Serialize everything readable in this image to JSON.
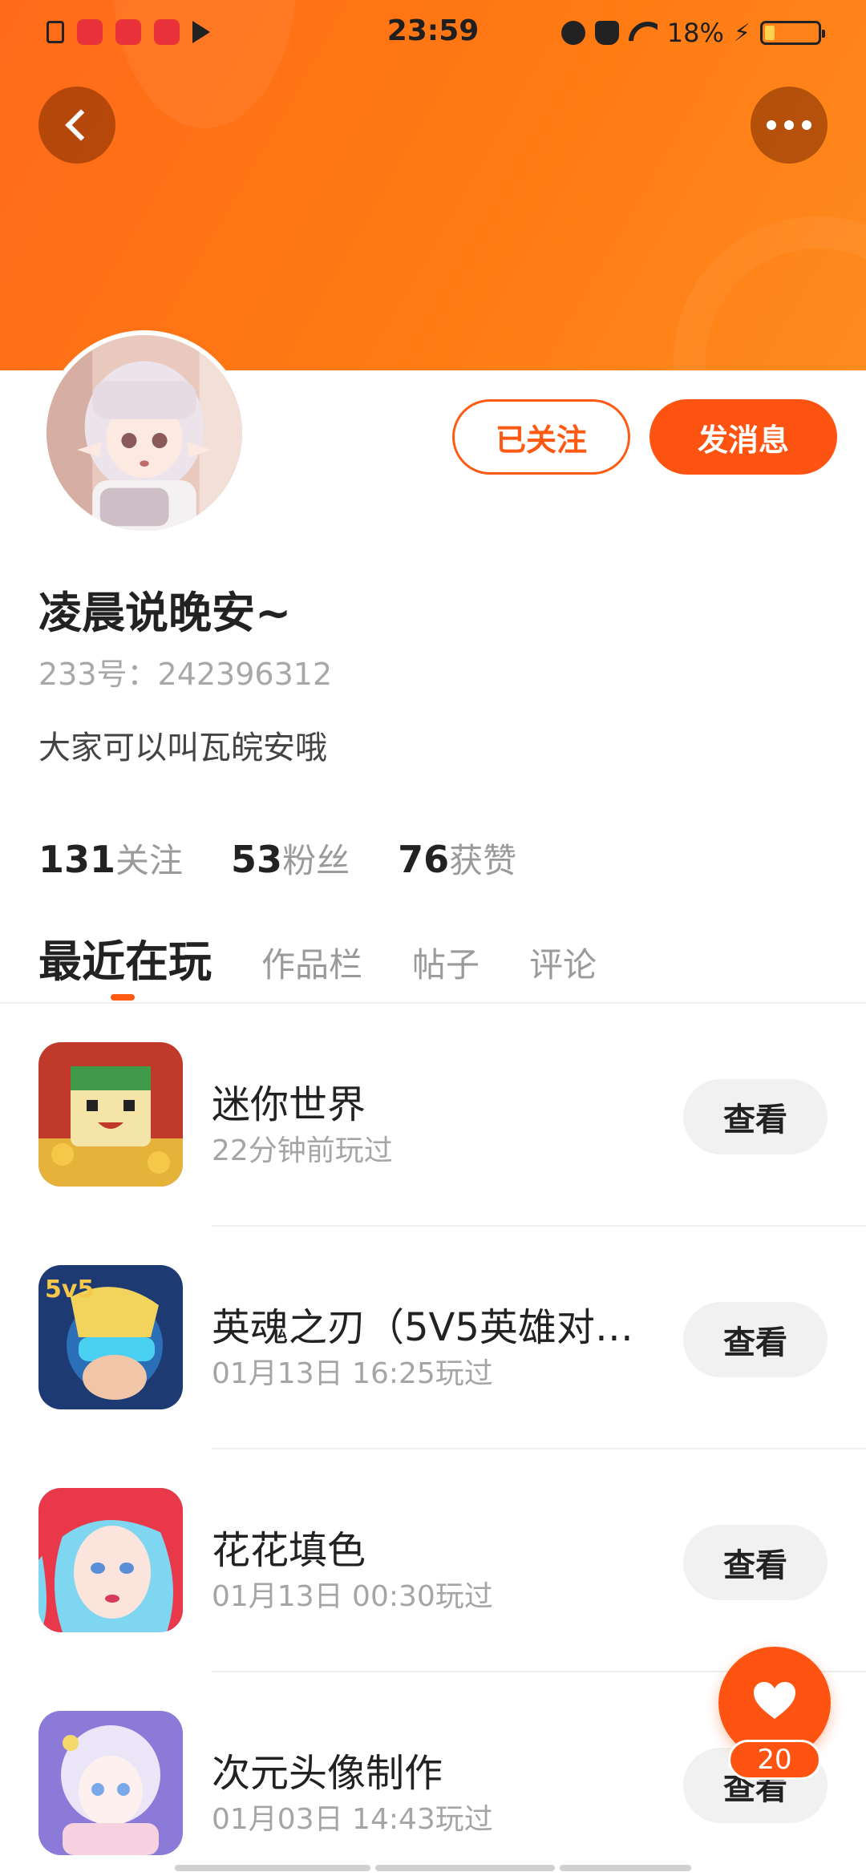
{
  "status_bar": {
    "time": "23:59",
    "battery_percent": "18%",
    "battery_level": 0.18,
    "notification_apps": [
      "file-icon",
      "news-app-icon",
      "video-app-icon",
      "video-app-icon",
      "play-icon"
    ]
  },
  "header": {
    "back_icon": "chevron-left-icon",
    "more_icon": "more-horizontal-icon",
    "banner_color": "#ff6a1a"
  },
  "profile": {
    "follow_label": "已关注",
    "message_label": "发消息",
    "nickname": "凌晨说晚安~",
    "uid": "233号：242396312",
    "bio": "大家可以叫瓦皖安哦",
    "stats": [
      {
        "num": "131",
        "label": "关注"
      },
      {
        "num": "53",
        "label": "粉丝"
      },
      {
        "num": "76",
        "label": "获赞"
      }
    ]
  },
  "tabs": [
    {
      "label": "最近在玩",
      "active": true
    },
    {
      "label": "作品栏",
      "active": false
    },
    {
      "label": "帖子",
      "active": false
    },
    {
      "label": "评论",
      "active": false
    }
  ],
  "games": [
    {
      "name": "迷你世界",
      "time": "22分钟前玩过",
      "button": "查看"
    },
    {
      "name": "英魂之刃（5V5英雄对…",
      "time": "01月13日 16:25玩过",
      "button": "查看"
    },
    {
      "name": "花花填色",
      "time": "01月13日 00:30玩过",
      "button": "查看"
    },
    {
      "name": "次元头像制作",
      "time": "01月03日 14:43玩过",
      "button": "查看"
    }
  ],
  "like_fab": {
    "icon": "heart-icon",
    "count": "20"
  },
  "colors": {
    "accent": "#ff5311",
    "muted_text": "#a5a5a5"
  }
}
